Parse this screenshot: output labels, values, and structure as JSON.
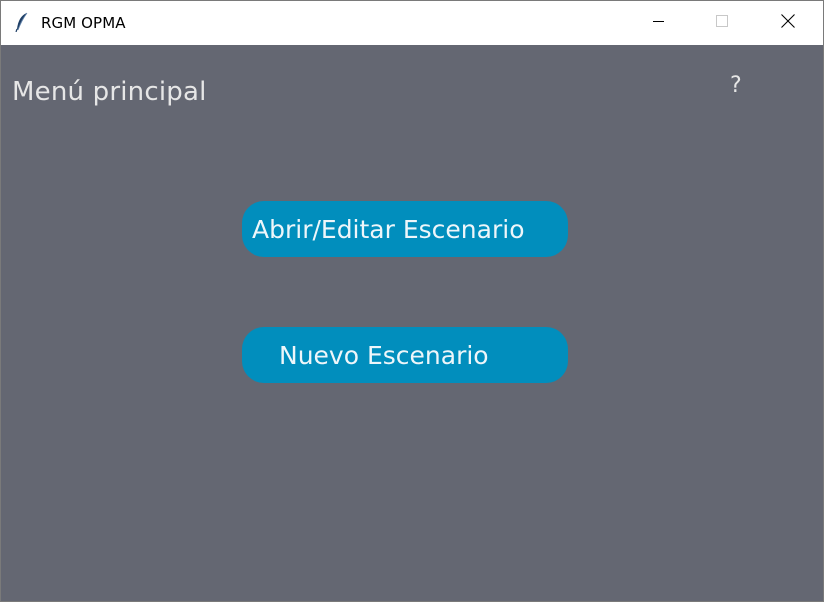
{
  "window": {
    "title": "RGM OPMA",
    "app_icon": "feather-icon",
    "controls": {
      "minimize_icon": "minimize-icon",
      "maximize_icon": "maximize-icon",
      "close_icon": "close-icon"
    }
  },
  "main": {
    "title": "Menú principal",
    "help_label": "?",
    "buttons": [
      {
        "label": "Abrir/Editar Escenario"
      },
      {
        "label": "Nuevo Escenario"
      }
    ]
  },
  "colors": {
    "background": "#646772",
    "button": "#018ebd",
    "text": "#e6e6e6"
  }
}
